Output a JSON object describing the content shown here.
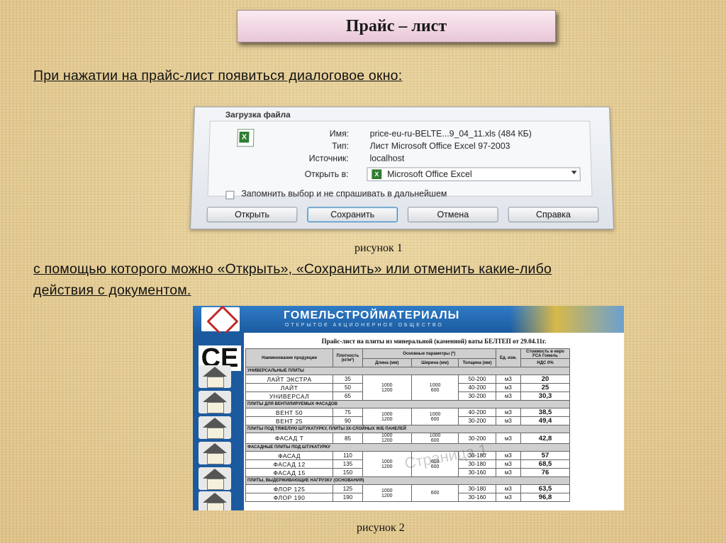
{
  "slide": {
    "title": "Прайс – лист",
    "intro": "При нажатии на прайс-лист появиться диалоговое окно:",
    "figure1_caption": "рисунок 1",
    "explain_line1": "с помощью которого можно «Открыть», «Сохранить» или отменить какие-либо",
    "explain_line2": "действия с документом.",
    "figure2_caption": "рисунок 2"
  },
  "dialog": {
    "title": "Загрузка файла",
    "fields": [
      {
        "label": "Имя:",
        "value": "price-eu-ru-BELTE...9_04_11.xls (484 КБ)"
      },
      {
        "label": "Тип:",
        "value": "Лист Microsoft Office Excel 97-2003"
      },
      {
        "label": "Источник:",
        "value": "localhost"
      }
    ],
    "open_with_label": "Открыть в:",
    "open_with_value": "Microsoft Office Excel",
    "remember_label": "Запомнить выбор и не спрашивать в дальнейшем",
    "buttons": {
      "open": "Открыть",
      "save": "Сохранить",
      "cancel": "Отмена",
      "help": "Справка"
    }
  },
  "pricelist": {
    "company": "ГОМЕЛЬСТРОЙМАТЕРИАЛЫ",
    "company_sub": "ОТКРЫТОЕ АКЦИОНЕРНОЕ ОБЩЕСТВО",
    "ce_mark": "CE",
    "title": "Прайс-лист на плиты из минеральной (каменной) ваты БЕЛТЕП от 29.04.11г.",
    "headers": {
      "name": "Наименование продукции",
      "density": "Плотность (кг/м³)",
      "main_params": "Основные параметры (*)",
      "length": "Длина (мм)",
      "width": "Ширина (мм)",
      "thickness": "Толщина (мм)",
      "unit": "Ед. изм.",
      "price": "Стоимость в евро FCA Гомель",
      "vat": "НДС 0%"
    },
    "watermark": "Страница 1",
    "sections": [
      {
        "category": "УНИВЕРСАЛЬНЫЕ ПЛИТЫ",
        "dims_len": "1000\n1200",
        "dims_wid": "1000\n600",
        "rows": [
          {
            "name": "ЛАЙТ ЭКСТРА",
            "density": "35",
            "thickness": "50-200",
            "unit": "м3",
            "price": "20"
          },
          {
            "name": "ЛАЙТ",
            "density": "50",
            "thickness": "40-200",
            "unit": "м3",
            "price": "25"
          },
          {
            "name": "УНИВЕРСАЛ",
            "density": "65",
            "thickness": "30-200",
            "unit": "м3",
            "price": "30,3"
          }
        ]
      },
      {
        "category": "ПЛИТЫ ДЛЯ ВЕНТИЛИРУЕМЫХ ФАСАДОВ",
        "dims_len": "1000\n1200",
        "dims_wid": "1000\n600",
        "rows": [
          {
            "name": "ВЕНТ 50",
            "density": "75",
            "thickness": "40-200",
            "unit": "м3",
            "price": "38,5"
          },
          {
            "name": "ВЕНТ 25",
            "density": "90",
            "thickness": "30-200",
            "unit": "м3",
            "price": "49,4"
          }
        ]
      },
      {
        "category": "ПЛИТЫ ПОД ТЯЖЕЛУЮ ШТУКАТУРКУ, ПЛИТЫ 3Х-СЛОЙНЫХ Ж/Б ПАНЕЛЕЙ",
        "dims_len": "1000\n1200",
        "dims_wid": "1000\n600",
        "rows": [
          {
            "name": "ФАСАД Т",
            "density": "85",
            "thickness": "30-200",
            "unit": "м3",
            "price": "42,8"
          }
        ]
      },
      {
        "category": "ФАСАДНЫЕ ПЛИТЫ ПОД ШТУКАТУРКУ",
        "dims_len": "1000\n1200",
        "dims_wid": "600\n600",
        "rows": [
          {
            "name": "ФАСАД",
            "density": "110",
            "thickness": "30-180",
            "unit": "м3",
            "price": "57"
          },
          {
            "name": "ФАСАД 12",
            "density": "135",
            "thickness": "30-180",
            "unit": "м3",
            "price": "68,5"
          },
          {
            "name": "ФАСАД 15",
            "density": "150",
            "thickness": "30-160",
            "unit": "м3",
            "price": "76"
          }
        ]
      },
      {
        "category": "ПЛИТЫ, ВЫДЕРЖИВАЮЩИЕ НАГРУЗКУ (ОСНОВАНИЯ)",
        "dims_len": "1000\n1200",
        "dims_wid": "600",
        "rows": [
          {
            "name": "ФЛОР 125",
            "density": "125",
            "thickness": "30-180",
            "unit": "м3",
            "price": "63,5"
          },
          {
            "name": "ФЛОР 190",
            "density": "190",
            "thickness": "30-160",
            "unit": "м3",
            "price": "96,8"
          }
        ]
      }
    ]
  }
}
